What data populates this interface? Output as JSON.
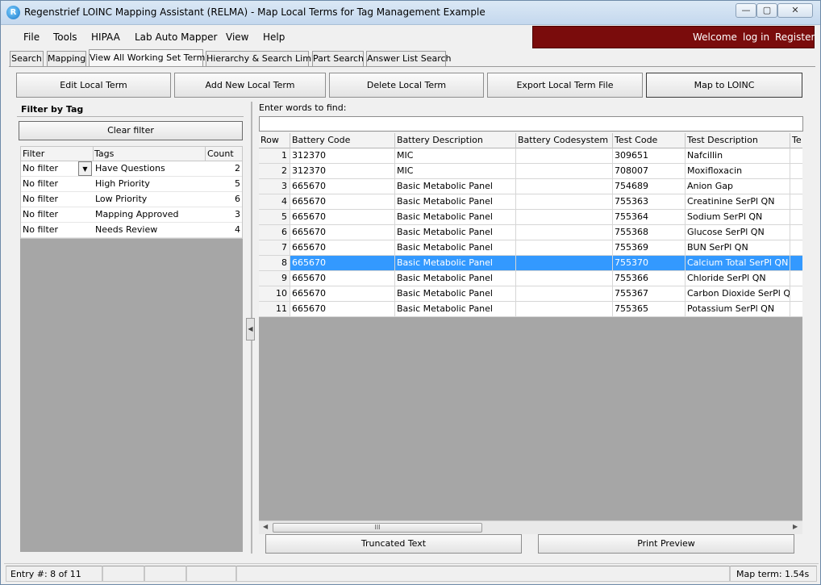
{
  "window": {
    "title": "Regenstrief LOINC Mapping Assistant (RELMA) - Map Local Terms  for Tag Management Example",
    "app_icon_glyph": "R",
    "controls": {
      "minimize": "—",
      "maximize": "▢",
      "close": "✕"
    }
  },
  "menu": [
    "File",
    "Tools",
    "HIPAA",
    "Lab Auto Mapper",
    "View",
    "Help"
  ],
  "account": {
    "welcome": "Welcome",
    "login": "log in",
    "register": "Register"
  },
  "tabs": [
    {
      "label": "Search",
      "active": false
    },
    {
      "label": "Mapping",
      "active": false
    },
    {
      "label": "View All Working Set Terms",
      "active": true
    },
    {
      "label": "Hierarchy & Search Limits",
      "active": false
    },
    {
      "label": "Part Search",
      "active": false
    },
    {
      "label": "Answer List Search",
      "active": false
    }
  ],
  "toolbar": {
    "edit": "Edit Local Term",
    "add": "Add New Local Term",
    "delete": "Delete Local Term",
    "export": "Export Local Term File",
    "map": "Map to LOINC"
  },
  "filter_panel": {
    "title": "Filter by Tag",
    "clear": "Clear filter",
    "headers": {
      "filter": "Filter",
      "tags": "Tags",
      "count": "Count"
    },
    "rows": [
      {
        "filter": "No filter",
        "tag": "Have Questions",
        "count": "2"
      },
      {
        "filter": "No filter",
        "tag": "High Priority",
        "count": "5"
      },
      {
        "filter": "No filter",
        "tag": "Low Priority",
        "count": "6"
      },
      {
        "filter": "No filter",
        "tag": "Mapping Approved",
        "count": "3"
      },
      {
        "filter": "No filter",
        "tag": "Needs Review",
        "count": "4"
      }
    ]
  },
  "search": {
    "label": "Enter words to find:",
    "value": ""
  },
  "grid": {
    "headers": {
      "row": "Row",
      "bc": "Battery Code",
      "bd": "Battery Description",
      "bcs": "Battery Codesystem",
      "tc": "Test Code",
      "td": "Test Description",
      "te": "Te"
    },
    "selected_row": 8,
    "rows": [
      {
        "row": "1",
        "bc": "312370",
        "bd": "MIC",
        "bcs": "",
        "tc": "309651",
        "td": "Nafcillin"
      },
      {
        "row": "2",
        "bc": "312370",
        "bd": "MIC",
        "bcs": "",
        "tc": "708007",
        "td": "Moxifloxacin"
      },
      {
        "row": "3",
        "bc": "665670",
        "bd": "Basic Metabolic Panel",
        "bcs": "",
        "tc": "754689",
        "td": "Anion Gap"
      },
      {
        "row": "4",
        "bc": "665670",
        "bd": "Basic Metabolic Panel",
        "bcs": "",
        "tc": "755363",
        "td": "Creatinine SerPl QN"
      },
      {
        "row": "5",
        "bc": "665670",
        "bd": "Basic Metabolic Panel",
        "bcs": "",
        "tc": "755364",
        "td": "Sodium SerPl QN"
      },
      {
        "row": "6",
        "bc": "665670",
        "bd": "Basic Metabolic Panel",
        "bcs": "",
        "tc": "755368",
        "td": "Glucose SerPl QN"
      },
      {
        "row": "7",
        "bc": "665670",
        "bd": "Basic Metabolic Panel",
        "bcs": "",
        "tc": "755369",
        "td": "BUN SerPl QN"
      },
      {
        "row": "8",
        "bc": "665670",
        "bd": "Basic Metabolic Panel",
        "bcs": "",
        "tc": "755370",
        "td": "Calcium Total SerPl QN"
      },
      {
        "row": "9",
        "bc": "665670",
        "bd": "Basic Metabolic Panel",
        "bcs": "",
        "tc": "755366",
        "td": "Chloride SerPl QN"
      },
      {
        "row": "10",
        "bc": "665670",
        "bd": "Basic Metabolic Panel",
        "bcs": "",
        "tc": "755367",
        "td": "Carbon Dioxide SerPl QN"
      },
      {
        "row": "11",
        "bc": "665670",
        "bd": "Basic Metabolic Panel",
        "bcs": "",
        "tc": "755365",
        "td": "Potassium SerPl QN"
      }
    ],
    "scroll_grip": "III"
  },
  "bottom": {
    "truncated": "Truncated Text",
    "print_preview": "Print Preview"
  },
  "status": {
    "entry": "Entry #: 8 of 11",
    "map_term": "Map term: 1.54s"
  }
}
